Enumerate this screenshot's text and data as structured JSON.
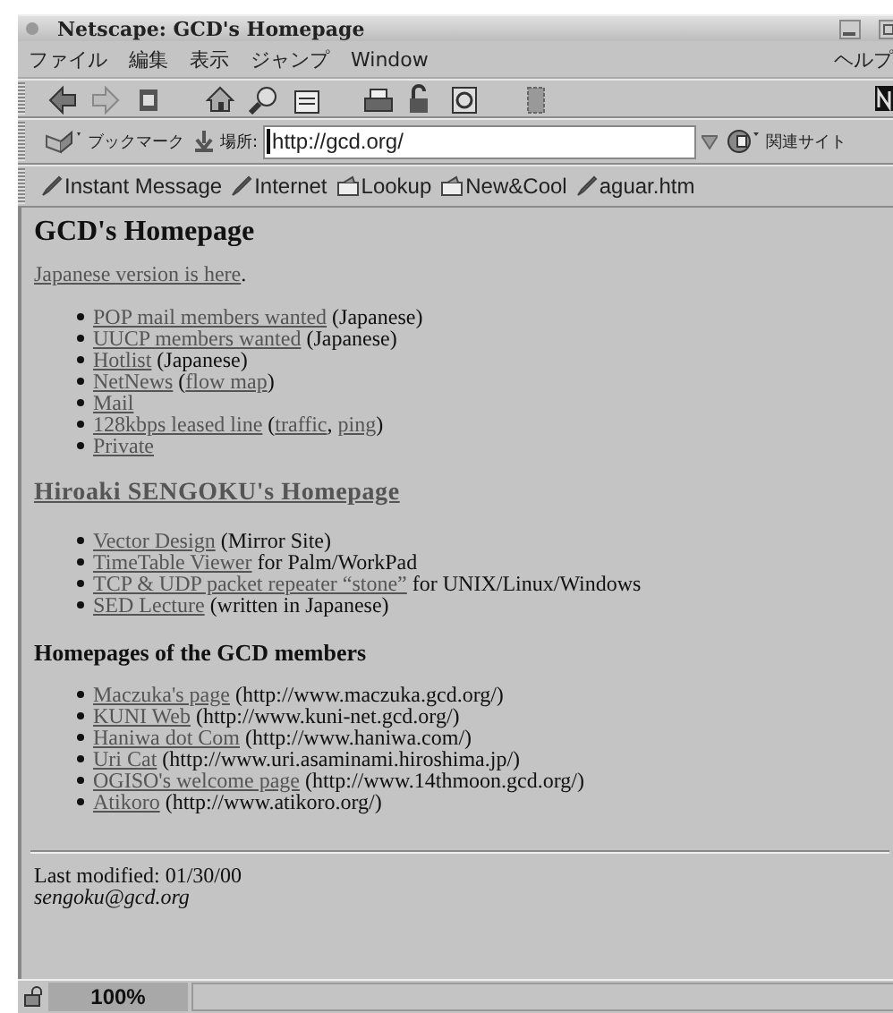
{
  "window": {
    "title": "Netscape: GCD's Homepage"
  },
  "menu": [
    {
      "label": "ファイル"
    },
    {
      "label": "編集"
    },
    {
      "label": "表示"
    },
    {
      "label": "ジャンプ"
    },
    {
      "label": "Window"
    },
    {
      "label": "ヘルプ"
    }
  ],
  "location_bar": {
    "bookmarks_label": "ブックマーク",
    "location_label": "場所:",
    "url": "http://gcd.org/",
    "related_label": "関連サイト"
  },
  "personal_toolbar": [
    {
      "label": "Instant Message",
      "kind": "bookmark"
    },
    {
      "label": "Internet",
      "kind": "bookmark"
    },
    {
      "label": "Lookup",
      "kind": "folder"
    },
    {
      "label": "New&Cool",
      "kind": "folder"
    },
    {
      "label": "aguar.htm",
      "kind": "bookmark"
    }
  ],
  "page": {
    "title": "GCD's Homepage",
    "intro": [
      {
        "text": "Japanese version is here",
        "link": true
      },
      {
        "text": ".",
        "link": false
      }
    ],
    "sections": [
      {
        "items": [
          [
            {
              "text": "POP mail members wanted",
              "link": true
            },
            {
              "text": " (Japanese)",
              "link": false
            }
          ],
          [
            {
              "text": "UUCP members wanted",
              "link": true
            },
            {
              "text": " (Japanese)",
              "link": false
            }
          ],
          [
            {
              "text": "Hotlist",
              "link": true
            },
            {
              "text": " (Japanese)",
              "link": false
            }
          ],
          [
            {
              "text": "NetNews",
              "link": true
            },
            {
              "text": " (",
              "link": false
            },
            {
              "text": "flow map",
              "link": true
            },
            {
              "text": ")",
              "link": false
            }
          ],
          [
            {
              "text": "Mail",
              "link": true
            }
          ],
          [
            {
              "text": "128kbps leased line",
              "link": true
            },
            {
              "text": " (",
              "link": false
            },
            {
              "text": "traffic",
              "link": true
            },
            {
              "text": ", ",
              "link": false
            },
            {
              "text": "ping",
              "link": true
            },
            {
              "text": ")",
              "link": false
            }
          ],
          [
            {
              "text": "Private",
              "link": true
            }
          ]
        ]
      },
      {
        "heading": "Hiroaki SENGOKU's Homepage",
        "heading_link": true,
        "items": [
          [
            {
              "text": "Vector Design",
              "link": true
            },
            {
              "text": " (Mirror Site)",
              "link": false
            }
          ],
          [
            {
              "text": "TimeTable Viewer",
              "link": true
            },
            {
              "text": " for Palm/WorkPad",
              "link": false
            }
          ],
          [
            {
              "text": "TCP & UDP packet repeater “stone”",
              "link": true
            },
            {
              "text": " for UNIX/Linux/Windows",
              "link": false
            }
          ],
          [
            {
              "text": "SED Lecture",
              "link": true
            },
            {
              "text": " (written in Japanese)",
              "link": false
            }
          ]
        ]
      },
      {
        "heading": "Homepages of the GCD members",
        "heading_link": false,
        "items": [
          [
            {
              "text": "Maczuka's page",
              "link": true
            },
            {
              "text": " (http://www.maczuka.gcd.org/)",
              "link": false
            }
          ],
          [
            {
              "text": "KUNI Web",
              "link": true
            },
            {
              "text": " (http://www.kuni-net.gcd.org/)",
              "link": false
            }
          ],
          [
            {
              "text": "Haniwa dot Com",
              "link": true
            },
            {
              "text": " (http://www.haniwa.com/)",
              "link": false
            }
          ],
          [
            {
              "text": "Uri Cat",
              "link": true
            },
            {
              "text": " (http://www.uri.asaminami.hiroshima.jp/)",
              "link": false
            }
          ],
          [
            {
              "text": "OGISO's welcome page",
              "link": true
            },
            {
              "text": " (http://www.14thmoon.gcd.org/)",
              "link": false
            }
          ],
          [
            {
              "text": "Atikoro",
              "link": true
            },
            {
              "text": " (http://www.atikoro.org/)",
              "link": false
            }
          ]
        ]
      }
    ],
    "last_modified": "Last modified: 01/30/00",
    "email": "sengoku@gcd.org"
  },
  "status_bar": {
    "progress": "100%"
  }
}
